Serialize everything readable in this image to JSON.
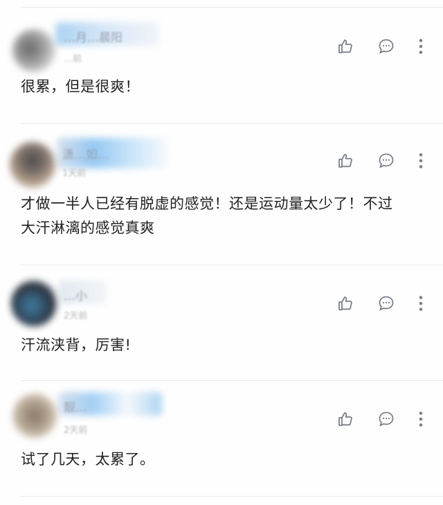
{
  "comments": [
    {
      "name": "…月…晨阳",
      "time": "…前",
      "text": "很累，但是很爽！",
      "avatar_colors": [
        "#5a5a5a",
        "#c9c9c9"
      ]
    },
    {
      "name": "潇…如…",
      "time": "1天前",
      "text_line1": "才做一半人已经有脱虚的感觉！还是运动量太少了！不过",
      "text_line2": "大汗淋漓的感觉真爽",
      "avatar_colors": [
        "#3a3a3a",
        "#b09a86"
      ]
    },
    {
      "name": "…小",
      "time": "2天前",
      "text": "汗流浃背，厉害!",
      "avatar_colors": [
        "#2a6f9a",
        "#121822"
      ]
    },
    {
      "name": "靓…",
      "time": "2天前",
      "text": "试了几天，太累了。",
      "avatar_colors": [
        "#7a6a5a",
        "#c7b8a4"
      ]
    }
  ],
  "icons": {
    "like": "thumbs-up-icon",
    "reply": "comment-bubble-icon",
    "more": "more-vertical-icon"
  },
  "colors": {
    "text": "#222222",
    "icon": "#7a7f8a",
    "divider": "#ececec",
    "name_blur": "#6ab0e8"
  }
}
